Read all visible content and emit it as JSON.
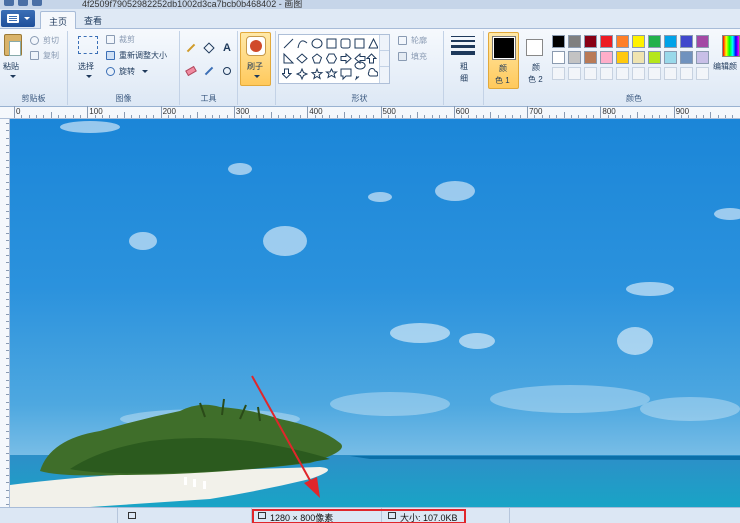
{
  "window": {
    "title": "4f2509f79052982252db1002d3ca7bcb0b468402 - 画图"
  },
  "tabs": [
    {
      "label": "主页"
    },
    {
      "label": "查看"
    }
  ],
  "ribbon": {
    "clipboard": {
      "paste": "粘贴",
      "cut": "剪切",
      "copy": "复制",
      "group_label": "剪贴板"
    },
    "image": {
      "select": "选择",
      "crop": "裁剪",
      "resize": "重新调整大小",
      "rotate": "旋转",
      "group_label": "图像"
    },
    "tools": {
      "group_label": "工具"
    },
    "brushes": {
      "label": "刷子"
    },
    "shapes": {
      "outline": "轮廓",
      "fill": "填充",
      "group_label": "形状"
    },
    "size": {
      "label_top": "粗",
      "label_bottom": "细"
    },
    "color1": {
      "label_top": "颜",
      "label_bottom": "色 1",
      "color": "#000000"
    },
    "color2": {
      "label_top": "颜",
      "label_bottom": "色 2",
      "color": "#ffffff"
    },
    "colors": {
      "group_label": "颜色",
      "edit_label": "编辑颜",
      "row1": [
        "#000000",
        "#7f7f7f",
        "#880015",
        "#ed1c24",
        "#ff7f27",
        "#fff200",
        "#22b14c",
        "#00a2e8",
        "#3f48cc",
        "#a349a4"
      ],
      "row2": [
        "#ffffff",
        "#c3c3c3",
        "#b97a57",
        "#ffaec9",
        "#ffc90e",
        "#efe4b0",
        "#b5e61d",
        "#99d9ea",
        "#7092be",
        "#c8bfe7"
      ]
    }
  },
  "ruler": {
    "marks": [
      "0",
      "100",
      "200",
      "300",
      "400",
      "500",
      "600",
      "700",
      "800",
      "900"
    ]
  },
  "status": {
    "dimensions": "1280 × 800像素",
    "size": "大小: 107.0KB"
  }
}
